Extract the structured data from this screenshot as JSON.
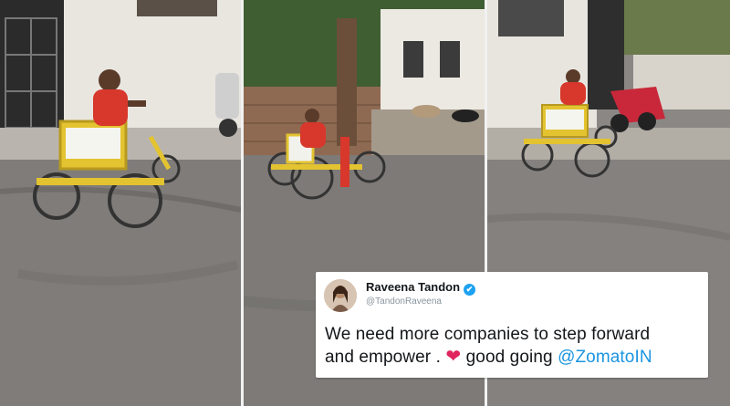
{
  "tweet": {
    "display_name": "Raveena Tandon",
    "handle": "@TandonRaveena",
    "text_line1": "We need more companies to step forward",
    "text_line2_start": "and empower .",
    "heart": "❤",
    "text_line2_middle": "good going",
    "mention": "@ZomatoIN",
    "verified_icon": "✔"
  },
  "colors": {
    "mention": "#1b95e0",
    "heart": "#e0245e",
    "verified": "#1da1f2",
    "delivery_shirt": "#d8372c",
    "tricycle": "#e3c330"
  }
}
